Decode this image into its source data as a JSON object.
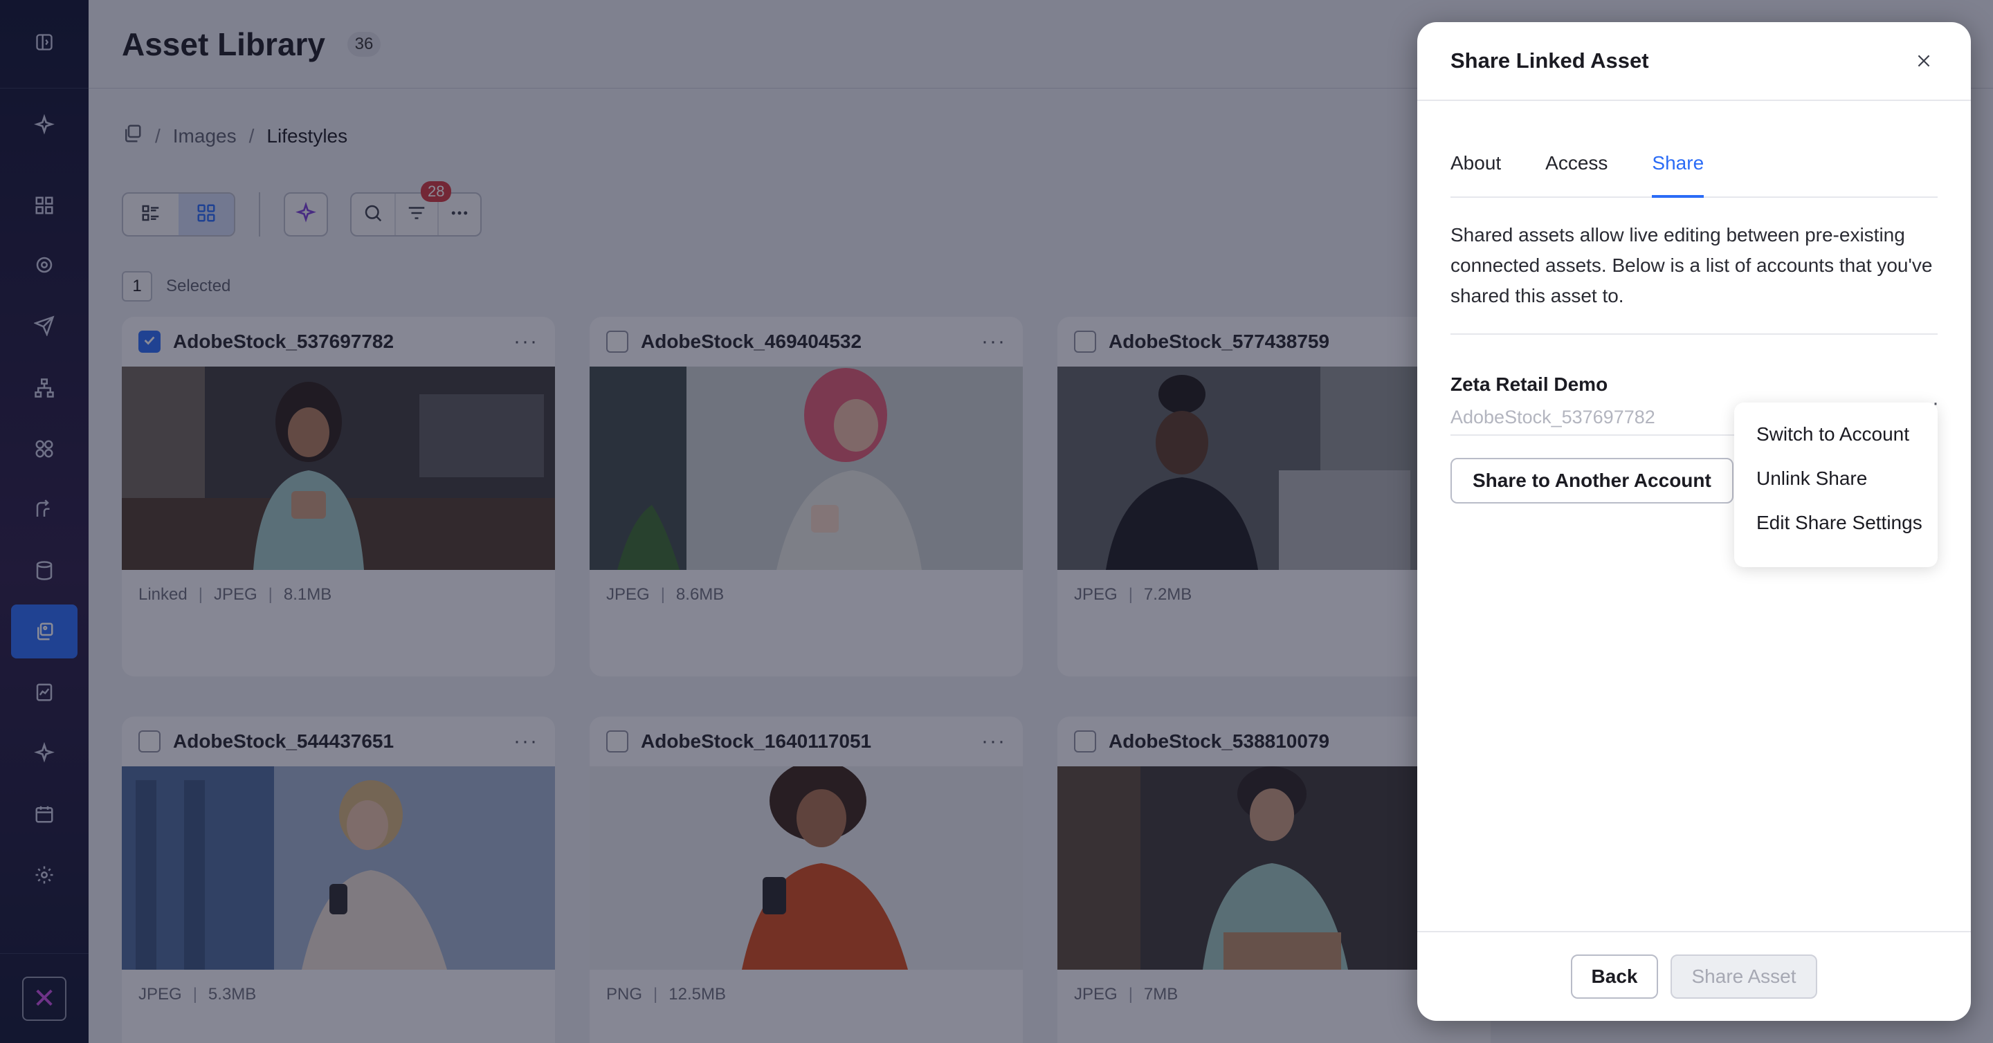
{
  "sidebar": {
    "icons": [
      "sidebar-toggle-icon",
      "sparkle-icon",
      "grid-icon",
      "target-icon",
      "send-icon",
      "hierarchy-icon",
      "segments-icon",
      "journey-icon",
      "database-icon",
      "asset-library-icon",
      "report-icon",
      "ai-icon",
      "calendar-icon",
      "settings-icon"
    ],
    "active": "asset-library-icon",
    "accent": "#2b6cf6"
  },
  "header": {
    "title": "Asset Library",
    "count": "36"
  },
  "breadcrumb": {
    "sep1": "/",
    "level1": "Images",
    "sep2": "/",
    "current": "Lifestyles"
  },
  "toolbar": {
    "filter_badge": "28"
  },
  "selection": {
    "count": "1",
    "label": "Selected"
  },
  "cards": [
    {
      "name": "AdobeStock_537697782",
      "checked": true,
      "linked": "Linked",
      "format": "JPEG",
      "size": "8.1MB"
    },
    {
      "name": "AdobeStock_469404532",
      "checked": false,
      "format": "JPEG",
      "size": "8.6MB"
    },
    {
      "name": "AdobeStock_577438759",
      "checked": false,
      "format": "JPEG",
      "size": "7.2MB"
    },
    {
      "name": "AdobeStock_544437651",
      "checked": false,
      "format": "JPEG",
      "size": "5.3MB"
    },
    {
      "name": "AdobeStock_1640117051",
      "checked": false,
      "format": "PNG",
      "size": "12.5MB"
    },
    {
      "name": "AdobeStock_538810079",
      "checked": false,
      "format": "JPEG",
      "size": "7MB"
    }
  ],
  "more_glyph": "···",
  "meta_sep": "|",
  "modal": {
    "title": "Share Linked Asset",
    "tabs": [
      "About",
      "Access",
      "Share"
    ],
    "active_tab": "Share",
    "description": "Shared assets allow live editing between pre-existing connected assets. Below is a list of accounts that you've shared this asset to.",
    "account_name": "Zeta Retail Demo",
    "account_asset": "AdobeStock_537697782",
    "share_another": "Share to Another Account",
    "menu": [
      "Switch to Account",
      "Unlink Share",
      "Edit Share Settings"
    ],
    "back": "Back",
    "share_asset": "Share Asset"
  }
}
